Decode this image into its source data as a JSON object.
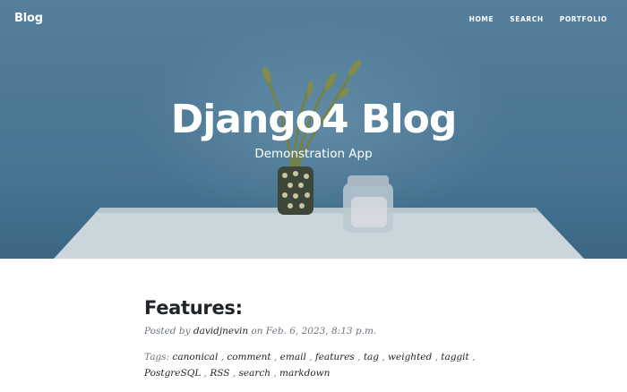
{
  "navbar": {
    "brand": "Blog",
    "links": [
      {
        "label": "HOME"
      },
      {
        "label": "SEARCH"
      },
      {
        "label": "PORTFOLIO"
      }
    ]
  },
  "hero": {
    "title": "Django4 Blog",
    "subtitle": "Demonstration App"
  },
  "post": {
    "title": "Features:",
    "meta_prefix": "Posted by",
    "author": "davidjnevin",
    "meta_on": "on",
    "date": "Feb. 6, 2023, 8:13 p.m.",
    "tags_label": "Tags:",
    "tags": [
      "canonical",
      "comment",
      "email",
      "features",
      "tag",
      "weighted",
      "taggit",
      "PostgreSQL",
      "RSS",
      "search",
      "markdown"
    ]
  },
  "colors": {
    "hero_blue": "#4f7f9f",
    "text_dark": "#212529",
    "text_muted": "#6c757d"
  }
}
